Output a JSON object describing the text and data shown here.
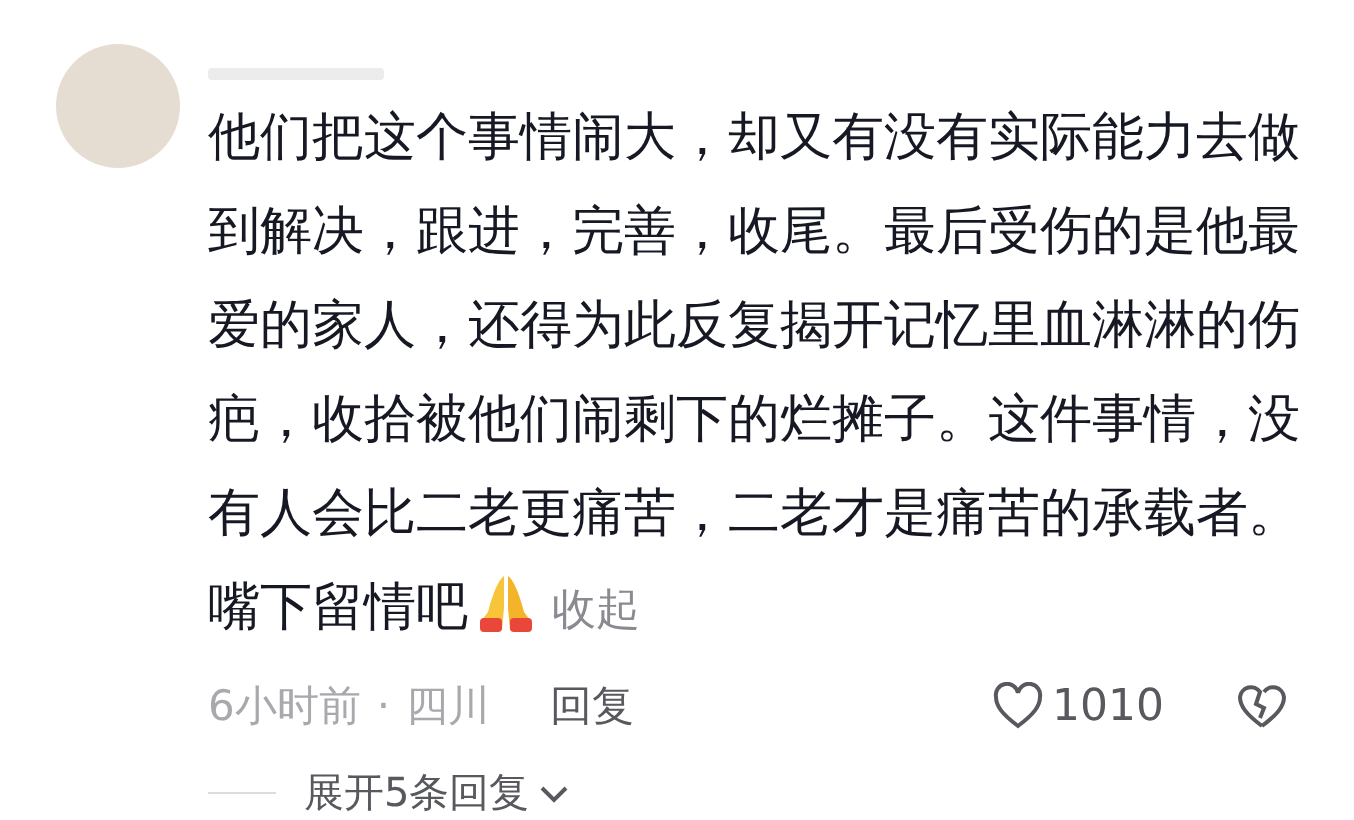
{
  "comment": {
    "body": "他们把这个事情闹大，却又有没有实际能力去做到解决，跟进，完善，收尾。最后受伤的是他最爱的家人，还得为此反复揭开记忆里血淋淋的伤疤，收拾被他们闹剩下的烂摊子。这件事情，没有人会比二老更痛苦，二老才是痛苦的承载者。嘴下留情吧",
    "collapse_link": "收起",
    "time": "6小时前",
    "separator": "·",
    "location": "四川",
    "reply_button": "回复",
    "like_count": "1010"
  },
  "expand_replies": "展开5条回复"
}
